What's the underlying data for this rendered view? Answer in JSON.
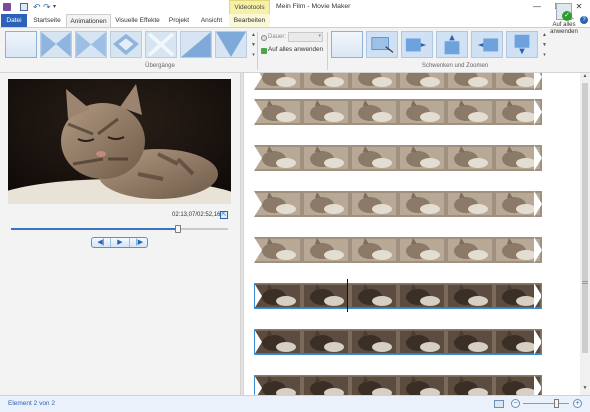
{
  "window": {
    "title": "Mein Film - Movie Maker",
    "contextual_tab": "Videotools",
    "minimize_symbol": "—",
    "maximize_symbol": "☐",
    "close_symbol": "✕"
  },
  "tabs": [
    {
      "label": "Datei"
    },
    {
      "label": "Startseite"
    },
    {
      "label": "Animationen"
    },
    {
      "label": "Visuelle Effekte"
    },
    {
      "label": "Projekt"
    },
    {
      "label": "Ansicht"
    },
    {
      "label": "Bearbeiten"
    }
  ],
  "ribbon": {
    "transitions_group_label": "Übergänge",
    "duration_label": "Dauer:",
    "duration_value": "",
    "apply_all_transitions_label": "Auf alles anwenden",
    "pan_zoom_group_label": "Schwenken und Zoomen",
    "apply_all_pan_label": "Auf alles anwenden"
  },
  "player": {
    "time_display": "02:13,07/02:52,16",
    "progress": 0.77
  },
  "timeline": {
    "row_count": 8,
    "selected_rows_start_index": 5
  },
  "status": {
    "text": "Element 2 von 2",
    "zoom_level": 0.72
  },
  "colors": {
    "accent": "#2b63b8",
    "selection": "#3b8fd4",
    "contextual_tab": "#f7f1a8"
  },
  "icons": {
    "app": "movie-maker-icon",
    "save": "save-icon",
    "undo": "undo-icon",
    "redo": "redo-icon",
    "help": "help-icon",
    "fullscreen": "fullscreen-icon",
    "apply_all": "apply-all-check-icon"
  }
}
